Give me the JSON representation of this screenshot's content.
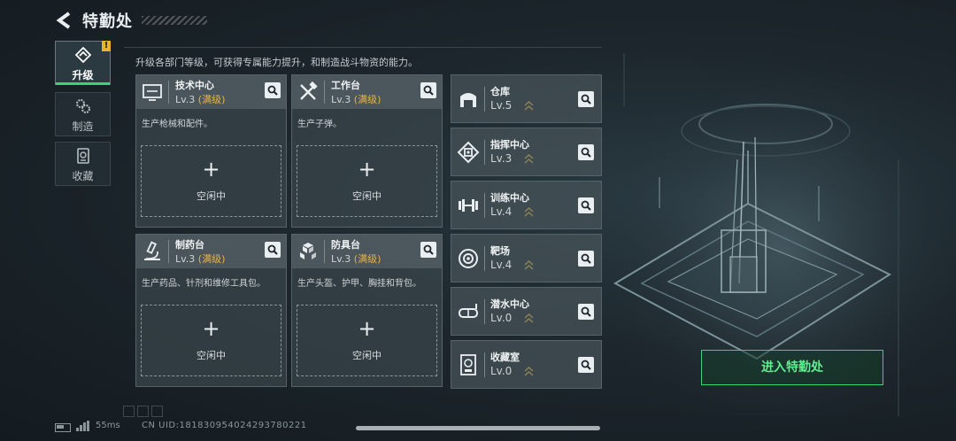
{
  "header": {
    "title": "特勤处"
  },
  "sidebar": {
    "tabs": [
      {
        "label": "升级",
        "icon": "upgrade-icon",
        "active": true,
        "badge": "!"
      },
      {
        "label": "制造",
        "icon": "gears-icon",
        "active": false
      },
      {
        "label": "收藏",
        "icon": "collection-icon",
        "active": false
      }
    ]
  },
  "main": {
    "description": "升级各部门等级，可获得专属能力提升，和制造战斗物资的能力。",
    "cards": [
      {
        "name": "技术中心",
        "level": "Lv.3",
        "max": "(满级)",
        "desc": "生产枪械和配件。",
        "plus": "+",
        "status": "空闲中",
        "icon": "monitor-icon"
      },
      {
        "name": "工作台",
        "level": "Lv.3",
        "max": "(满级)",
        "desc": "生产子弹。",
        "plus": "+",
        "status": "空闲中",
        "icon": "tools-icon"
      },
      {
        "name": "制药台",
        "level": "Lv.3",
        "max": "(满级)",
        "desc": "生产药品、针剂和维修工具包。",
        "plus": "+",
        "status": "空闲中",
        "icon": "microscope-icon"
      },
      {
        "name": "防具台",
        "level": "Lv.3",
        "max": "(满级)",
        "desc": "生产头盔、护甲、胸挂和背包。",
        "plus": "+",
        "status": "空闲中",
        "icon": "boxes-icon"
      }
    ],
    "rows": [
      {
        "name": "仓库",
        "level": "Lv.5",
        "icon": "warehouse-icon"
      },
      {
        "name": "指挥中心",
        "level": "Lv.3",
        "icon": "command-icon"
      },
      {
        "name": "训练中心",
        "level": "Lv.4",
        "icon": "dumbbell-icon"
      },
      {
        "name": "靶场",
        "level": "Lv.4",
        "icon": "target-icon"
      },
      {
        "name": "潜水中心",
        "level": "Lv.0",
        "icon": "diving-mask-icon"
      },
      {
        "name": "收藏室",
        "level": "Lv.0",
        "icon": "trophy-icon"
      }
    ]
  },
  "enter_button": {
    "label": "进入特勤处"
  },
  "status_bar": {
    "ping": "55ms",
    "uid": "CN UID:181830954024293780221"
  },
  "colors": {
    "accent_green": "#3bd37a",
    "max_level": "#e6b445",
    "badge": "#e8b42a"
  }
}
